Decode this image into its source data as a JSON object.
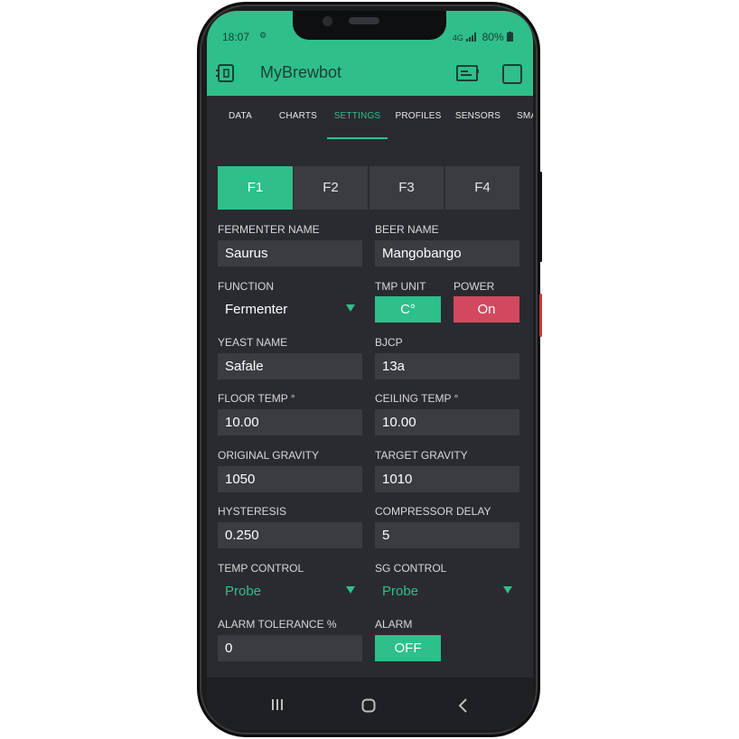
{
  "status_bar": {
    "time": "18:07",
    "signal_text": "4G",
    "battery": "80%"
  },
  "app_bar": {
    "title": "MyBrewbot",
    "left_icon": "device-icon",
    "right_icons": [
      "battery-card-icon",
      "square-icon"
    ]
  },
  "tabs": [
    {
      "label": "DATA",
      "active": false
    },
    {
      "label": "CHARTS",
      "active": false
    },
    {
      "label": "SETTINGS",
      "active": true
    },
    {
      "label": "PROFILES",
      "active": false
    },
    {
      "label": "SENSORS",
      "active": false
    },
    {
      "label": "SMA",
      "active": false
    }
  ],
  "fermenter_tabs": [
    {
      "label": "F1",
      "active": true
    },
    {
      "label": "F2",
      "active": false
    },
    {
      "label": "F3",
      "active": false
    },
    {
      "label": "F4",
      "active": false
    }
  ],
  "form": {
    "fermenter_name": {
      "label": "FERMENTER NAME",
      "value": "Saurus"
    },
    "beer_name": {
      "label": "BEER NAME",
      "value": "Mangobango"
    },
    "function": {
      "label": "FUNCTION",
      "value": "Fermenter"
    },
    "tmp_unit": {
      "label": "TMP UNIT",
      "value": "C°"
    },
    "power": {
      "label": "POWER",
      "value": "On"
    },
    "yeast_name": {
      "label": "YEAST NAME",
      "value": "Safale"
    },
    "bjcp": {
      "label": "BJCP",
      "value": "13a"
    },
    "floor_temp": {
      "label": "FLOOR TEMP °",
      "value": "10.00"
    },
    "ceiling_temp": {
      "label": "CEILING TEMP °",
      "value": "10.00"
    },
    "original_gravity": {
      "label": "ORIGINAL GRAVITY",
      "value": "1050"
    },
    "target_gravity": {
      "label": "TARGET GRAVITY",
      "value": "1010"
    },
    "hysteresis": {
      "label": "HYSTERESIS",
      "value": "0.250"
    },
    "compressor_delay": {
      "label": "COMPRESSOR DELAY",
      "value": "5"
    },
    "temp_control": {
      "label": "TEMP CONTROL",
      "value": "Probe"
    },
    "sg_control": {
      "label": "SG CONTROL",
      "value": "Probe"
    },
    "alarm_tolerance": {
      "label": "ALARM TOLERANCE %",
      "value": "0"
    },
    "alarm": {
      "label": "ALARM",
      "value": "OFF"
    }
  },
  "nav_bar": {
    "icons": [
      "recents-icon",
      "home-icon",
      "back-icon"
    ]
  },
  "colors": {
    "accent": "#2fbf8b",
    "danger": "#d2495f",
    "background": "#2a2b30",
    "field": "#3a3c41"
  }
}
